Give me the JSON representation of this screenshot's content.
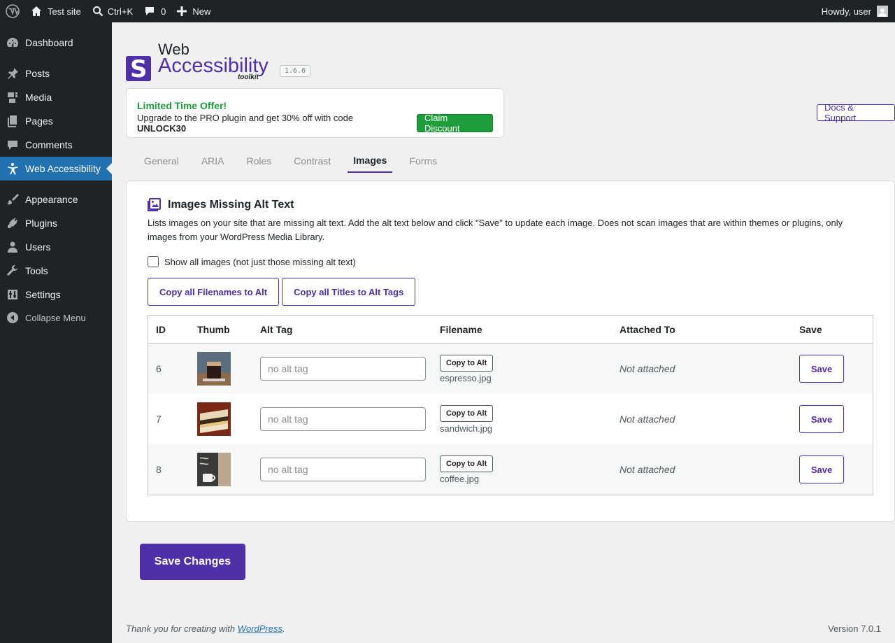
{
  "adminbar": {
    "site_name": "Test site",
    "search_shortcut": "Ctrl+K",
    "comments_count": "0",
    "new_label": "New",
    "greeting": "Howdy, user"
  },
  "sidebar": {
    "items": [
      {
        "label": "Dashboard",
        "icon": "dashboard-icon"
      },
      {
        "label": "Posts",
        "icon": "pin-icon"
      },
      {
        "label": "Media",
        "icon": "media-icon"
      },
      {
        "label": "Pages",
        "icon": "pages-icon"
      },
      {
        "label": "Comments",
        "icon": "comment-icon"
      },
      {
        "label": "Web Accessibility",
        "icon": "accessibility-icon"
      },
      {
        "label": "Appearance",
        "icon": "brush-icon"
      },
      {
        "label": "Plugins",
        "icon": "plug-icon"
      },
      {
        "label": "Users",
        "icon": "user-icon"
      },
      {
        "label": "Tools",
        "icon": "wrench-icon"
      },
      {
        "label": "Settings",
        "icon": "sliders-icon"
      }
    ],
    "collapse_label": "Collapse Menu"
  },
  "plugin": {
    "logo_line1": "Web",
    "logo_line2": "Accessibility",
    "logo_line3": "toolkit",
    "version": "1.6.6"
  },
  "offer": {
    "title": "Limited Time Offer!",
    "text": "Upgrade to the PRO plugin and get 30% off with code ",
    "code": "UNLOCK30",
    "button": "Claim Discount"
  },
  "docs_button": "Docs & Support",
  "tabs": [
    "General",
    "ARIA",
    "Roles",
    "Contrast",
    "Images",
    "Forms"
  ],
  "active_tab": "Images",
  "panel": {
    "title": "Images Missing Alt Text",
    "description": "Lists images on your site that are missing alt text. Add the alt text below and click \"Save\" to update each image. Does not scan images that are within themes or plugins, only images from your WordPress Media Library.",
    "show_all_label": "Show all images (not just those missing alt text)",
    "copy_filenames_button": "Copy all Filenames to Alt",
    "copy_titles_button": "Copy all Titles to Alt Tags"
  },
  "table": {
    "headers": {
      "id": "ID",
      "thumb": "Thumb",
      "alt": "Alt Tag",
      "filename": "Filename",
      "attached": "Attached To",
      "save": "Save"
    },
    "copy_label": "Copy to Alt",
    "save_label": "Save",
    "rows": [
      {
        "id": "6",
        "alt_placeholder": "no alt tag",
        "filename": "espresso.jpg",
        "attached": "Not attached",
        "thumb_icon": "espresso-thumbnail"
      },
      {
        "id": "7",
        "alt_placeholder": "no alt tag",
        "filename": "sandwich.jpg",
        "attached": "Not attached",
        "thumb_icon": "sandwich-thumbnail"
      },
      {
        "id": "8",
        "alt_placeholder": "no alt tag",
        "filename": "coffee.jpg",
        "attached": "Not attached",
        "thumb_icon": "coffee-thumbnail"
      }
    ]
  },
  "save_changes": "Save Changes",
  "footer": {
    "thanks_prefix": "Thank you for creating with ",
    "thanks_link": "WordPress",
    "thanks_suffix": ".",
    "version": "Version 7.0.1"
  },
  "colors": {
    "accent": "#4f2fa8",
    "admin_bar": "#1d2327",
    "current_menu": "#2271b1",
    "offer_green": "#1e9e3a"
  }
}
